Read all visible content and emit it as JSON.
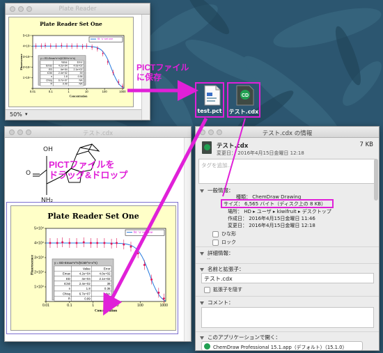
{
  "plate_window": {
    "title": "Plate Reader",
    "zoom": "50%"
  },
  "chart_small": {
    "title": "Plate Reader Set One"
  },
  "chart_large": {
    "title": "Plate Reader Set One"
  },
  "chart_data": [
    {
      "type": "scatter",
      "title": "Plate Reader Set One",
      "xlabel": "Concentration",
      "ylabel": "Fluorescence",
      "x_scale": "log",
      "x_ticks": [
        "0.01",
        "0.1",
        "1",
        "10",
        "100",
        "1000"
      ],
      "y_ticks": [
        "0",
        "1×10⁴",
        "2×10⁴",
        "3×10⁴",
        "4×10⁴",
        "5×10⁴"
      ],
      "legend": "f8: ‘u’ set one",
      "x": [
        0.015,
        0.03,
        0.05,
        0.1,
        0.2,
        0.4,
        0.8,
        1.5,
        3,
        6,
        10,
        20,
        40,
        80,
        150,
        300,
        600,
        1000
      ],
      "y": [
        40000,
        40000,
        40500,
        40000,
        40000,
        40500,
        40000,
        40000,
        40000,
        39500,
        40000,
        39000,
        37500,
        33000,
        25000,
        15000,
        6000,
        2000
      ],
      "ylim": [
        0,
        50000
      ],
      "xlim": [
        0.01,
        1200
      ],
      "fit_table": {
        "header": [
          "",
          "Value",
          "Error"
        ],
        "rows": [
          [
            "Emax",
            "4.2e+04",
            "4.0e+02"
          ],
          [
            "ED",
            "4e+04",
            "2.1e+02"
          ],
          [
            "IC50",
            "2.4e+02",
            "39"
          ],
          [
            "n",
            "1.8",
            "0.36"
          ],
          [
            "Chisq",
            "6.7e+07",
            "NA"
          ],
          [
            "R",
            "0.99",
            "NA"
          ]
        ],
        "formula": "y = ED-Emax*x^n/(IC50^n+x^n)"
      }
    }
  ],
  "desktop": {
    "annotation_save": "PICTファイル\nに保存",
    "annotation_drag": "PICTファイルを\nドラッグ&ドロップ",
    "file1_name": "test.pct",
    "file2_name": "テスト.cdx",
    "file2_icon": "CD"
  },
  "cdx_window": {
    "title": "テスト.cdx",
    "structure": {
      "oh": "OH",
      "o": "O",
      "nh2": "NH₂"
    }
  },
  "info_window": {
    "title": "テスト.cdx の情報",
    "filename": "テスト.cdx",
    "size_short": "7 KB",
    "modified_line": "変更日： 2016年4月15日金曜日 12:18",
    "tags_placeholder": "タグを追加...",
    "general_header": "一般情報：",
    "kind": "種類： ChemDraw Drawing",
    "size": "サイズ： 6,565 バイト（ディスク上の 8 KB）",
    "where": "場所： HD ▸ ユーザ ▸ kiwifruit ▸ デスクトップ",
    "created": "作成日： 2016年4月15日金曜日 11:46",
    "modified": "変更日： 2016年4月15日金曜日 12:18",
    "stationery": "ひな形",
    "locked": "ロック",
    "more_info_header": "詳細情報：",
    "more_info_value": "--",
    "name_ext_header": "名前と拡張子：",
    "name_value": "テスト.cdx",
    "hide_ext": "拡張子を隠す",
    "comment_header": "コメント：",
    "open_with_header": "このアプリケーションで開く：",
    "app": "ChemDraw Professional 15.1.app（デフォルト）（15.1.0）"
  },
  "colors": {
    "accent": "#e020d8",
    "plot_bg": "#ffffc8",
    "desktop": "#2c5670"
  }
}
